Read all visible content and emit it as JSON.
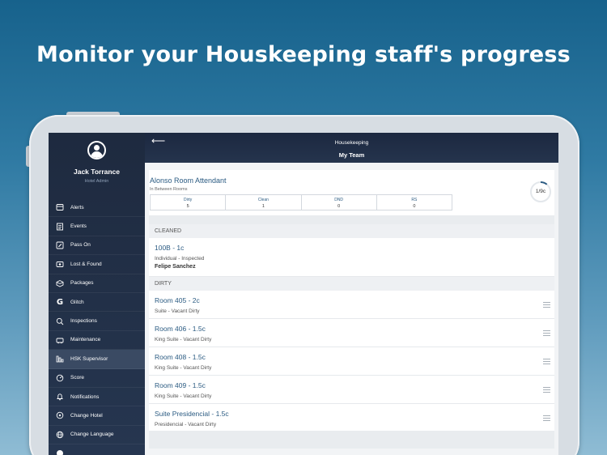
{
  "headline": "Monitor your Houskeeping staff's progress",
  "user": {
    "name": "Jack Torrance",
    "role": "Hotel Admin"
  },
  "nav": [
    {
      "label": "Alerts",
      "icon": "alerts-icon"
    },
    {
      "label": "Events",
      "icon": "events-icon"
    },
    {
      "label": "Pass On",
      "icon": "pass-on-icon"
    },
    {
      "label": "Lost & Found",
      "icon": "lost-found-icon"
    },
    {
      "label": "Packages",
      "icon": "packages-icon"
    },
    {
      "label": "Glitch",
      "icon": "glitch-icon"
    },
    {
      "label": "Inspections",
      "icon": "inspections-icon"
    },
    {
      "label": "Maintenance",
      "icon": "maintenance-icon"
    },
    {
      "label": "HSK Supervisor",
      "icon": "hsk-supervisor-icon",
      "active": true
    },
    {
      "label": "Score",
      "icon": "score-icon"
    },
    {
      "label": "Notifications",
      "icon": "notifications-icon"
    },
    {
      "label": "Change Hotel",
      "icon": "change-hotel-icon"
    },
    {
      "label": "Change Language",
      "icon": "globe-icon"
    }
  ],
  "topbar": {
    "back": "⟵",
    "title": "Housekeeping",
    "subtitle": "My Team"
  },
  "attendant": {
    "name": "Alonso Room Attendant",
    "status": "In Between Rooms",
    "progress_label": "1/9c",
    "progress_fraction": 0.11,
    "stats": [
      {
        "label": "Dirty",
        "value": "5"
      },
      {
        "label": "Clean",
        "value": "1"
      },
      {
        "label": "DND",
        "value": "0"
      },
      {
        "label": "RS",
        "value": "0"
      }
    ]
  },
  "sections": {
    "cleaned": {
      "header": "CLEANED",
      "rooms": [
        {
          "title": "100B - 1c",
          "subtitle": "Individual - Inspected",
          "staff": "Felipe Sanchez"
        }
      ]
    },
    "dirty": {
      "header": "DIRTY",
      "rooms": [
        {
          "title": "Room 405 - 2c",
          "subtitle": "Suite - Vacant Dirty"
        },
        {
          "title": "Room 406 - 1.5c",
          "subtitle": "King Suite - Vacant Dirty"
        },
        {
          "title": "Room 408 - 1.5c",
          "subtitle": "King Suite - Vacant Dirty"
        },
        {
          "title": "Room 409 - 1.5c",
          "subtitle": "King Suite - Vacant Dirty"
        },
        {
          "title": "Suite Presidencial - 1.5c",
          "subtitle": "Presidencial - Vacant Dirty"
        }
      ]
    }
  },
  "colors": {
    "accent": "#2b5b82",
    "sidebar": "#1e2a3f",
    "ring": "#2b5b82"
  }
}
